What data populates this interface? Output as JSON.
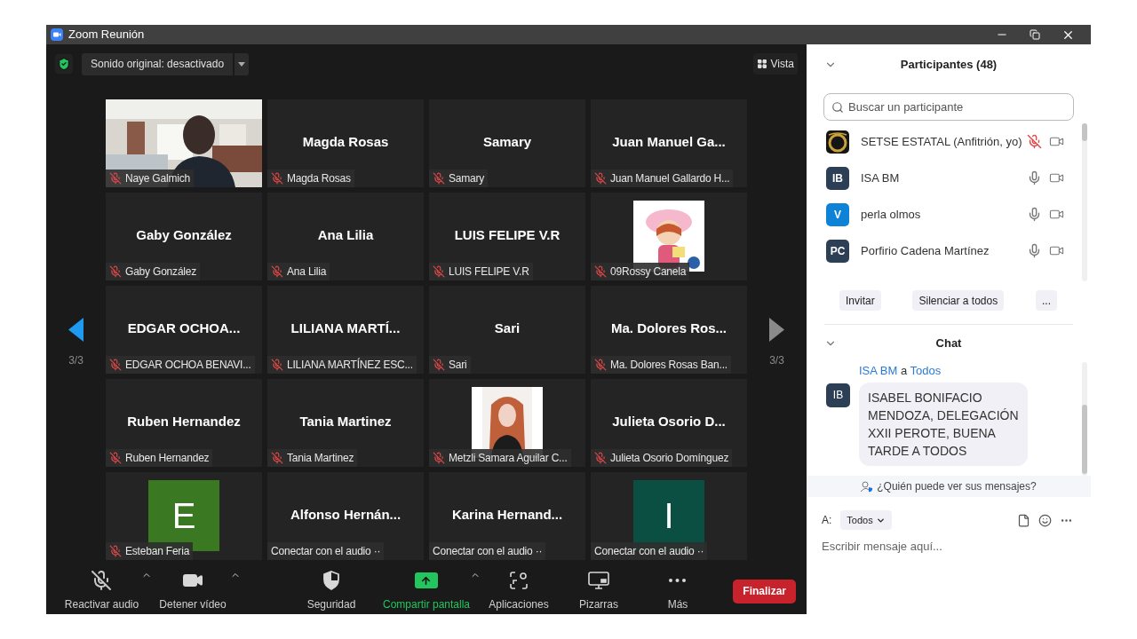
{
  "window": {
    "title": "Zoom Reunión"
  },
  "top_bar": {
    "audio_button": "Sonido original: desactivado",
    "view_button": "Vista"
  },
  "nav": [
    {
      "kind": "previous",
      "label": "3/3",
      "disabled": false
    },
    {
      "kind": "next",
      "label": "3/3",
      "disabled": true
    }
  ],
  "tiles": [
    {
      "kind": "picture",
      "label": "Naye Galmich",
      "muted": true
    },
    {
      "kind": "name",
      "title": "Magda Rosas",
      "label": "Magda Rosas",
      "muted": true
    },
    {
      "kind": "name",
      "title": "Samary",
      "label": "Samary",
      "muted": true
    },
    {
      "kind": "name",
      "title": "Juan Manuel Ga...",
      "label": "Juan Manuel Gallardo H...",
      "muted": true
    },
    {
      "kind": "name",
      "title": "Gaby González",
      "label": "Gaby González",
      "muted": true
    },
    {
      "kind": "name",
      "title": "Ana Lilia",
      "label": "Ana Lilia",
      "muted": true
    },
    {
      "kind": "name",
      "title": "LUIS FELIPE V.R",
      "label": "LUIS FELIPE V.R",
      "muted": true
    },
    {
      "kind": "thumbnail",
      "label": "09Rossy Canela",
      "muted": true
    },
    {
      "kind": "name",
      "title": "EDGAR  OCHOA...",
      "label": "EDGAR OCHOA BENAVI...",
      "muted": true
    },
    {
      "kind": "name",
      "title": "LILIANA MARTÍ...",
      "label": "LILIANA MARTÍNEZ ESC...",
      "muted": true
    },
    {
      "kind": "name",
      "title": "Sari",
      "label": "Sari",
      "muted": true
    },
    {
      "kind": "name",
      "title": "Ma. Dolores Ros...",
      "label": "Ma. Dolores Rosas Ban...",
      "muted": true
    },
    {
      "kind": "name",
      "title": "Ruben Hernandez",
      "label": "Ruben Hernandez",
      "muted": true
    },
    {
      "kind": "name",
      "title": "Tania Martinez",
      "label": "Tania Martinez",
      "muted": true
    },
    {
      "kind": "thumbnail",
      "label": "Metzli Samara Aguilar C...",
      "muted": true
    },
    {
      "kind": "name",
      "title": "Julieta Osorio D...",
      "label": "Julieta Osorio Domínguez",
      "muted": true
    },
    {
      "kind": "avatar",
      "letter": "E",
      "color": "#3a7822",
      "label": "Esteban Feria",
      "muted": true
    },
    {
      "kind": "name",
      "title": "Alfonso  Hernán...",
      "label": "Conectar con el audio ··",
      "muted": false
    },
    {
      "kind": "name",
      "title": "Karina  Hernand...",
      "label": "Conectar con el audio ··",
      "muted": false
    },
    {
      "kind": "avatar",
      "letter": "I",
      "color": "#0b4f42",
      "label": "Conectar con el audio ··",
      "muted": false
    }
  ],
  "toolbar": [
    {
      "kind": "mic-off",
      "label": "Reactivar audio",
      "menu": true
    },
    {
      "kind": "video",
      "label": "Detener vídeo",
      "menu": true
    },
    {
      "kind": "shield",
      "label": "Seguridad",
      "menu": false
    },
    {
      "kind": "share",
      "label": "Compartir pantalla",
      "menu": true
    },
    {
      "kind": "apps",
      "label": "Aplicaciones",
      "menu": false
    },
    {
      "kind": "whiteboard",
      "label": "Pizarras",
      "menu": false
    },
    {
      "kind": "more",
      "label": "Más",
      "menu": false
    }
  ],
  "end_button": "Finalizar",
  "participants": {
    "title": "Participantes (48)",
    "search_placeholder": "Buscar un participante",
    "items": [
      {
        "kind": "picture",
        "name": "SETSE ESTATAL (Anfitrión, yo)",
        "muted": true
      },
      {
        "kind": "initials",
        "initials": "IB",
        "color": "#2d3f55",
        "name": "ISA BM",
        "muted": false
      },
      {
        "kind": "initials",
        "initials": "V",
        "color": "#0e82d6",
        "name": "perla olmos",
        "muted": false
      },
      {
        "kind": "initials",
        "initials": "PC",
        "color": "#2d3f55",
        "name": "Porfirio Cadena Martínez",
        "muted": false
      }
    ],
    "buttons": [
      "Invitar",
      "Silenciar a todos",
      "..."
    ]
  },
  "chat": {
    "title": "Chat",
    "messages": [
      {
        "sender": "ISA BM",
        "connector": "a",
        "recipient": "Todos",
        "initials": "IB",
        "color": "#2d3f55",
        "text": "ISABEL BONIFACIO MENDOZA, DELEGACIÓN XXII PEROTE, BUENA TARDE A TODOS"
      }
    ],
    "privacy_note": "¿Quién puede ver sus mensajes?",
    "to_label": "A:",
    "to_value": "Todos",
    "placeholder": "Escribir mensaje aquí..."
  }
}
